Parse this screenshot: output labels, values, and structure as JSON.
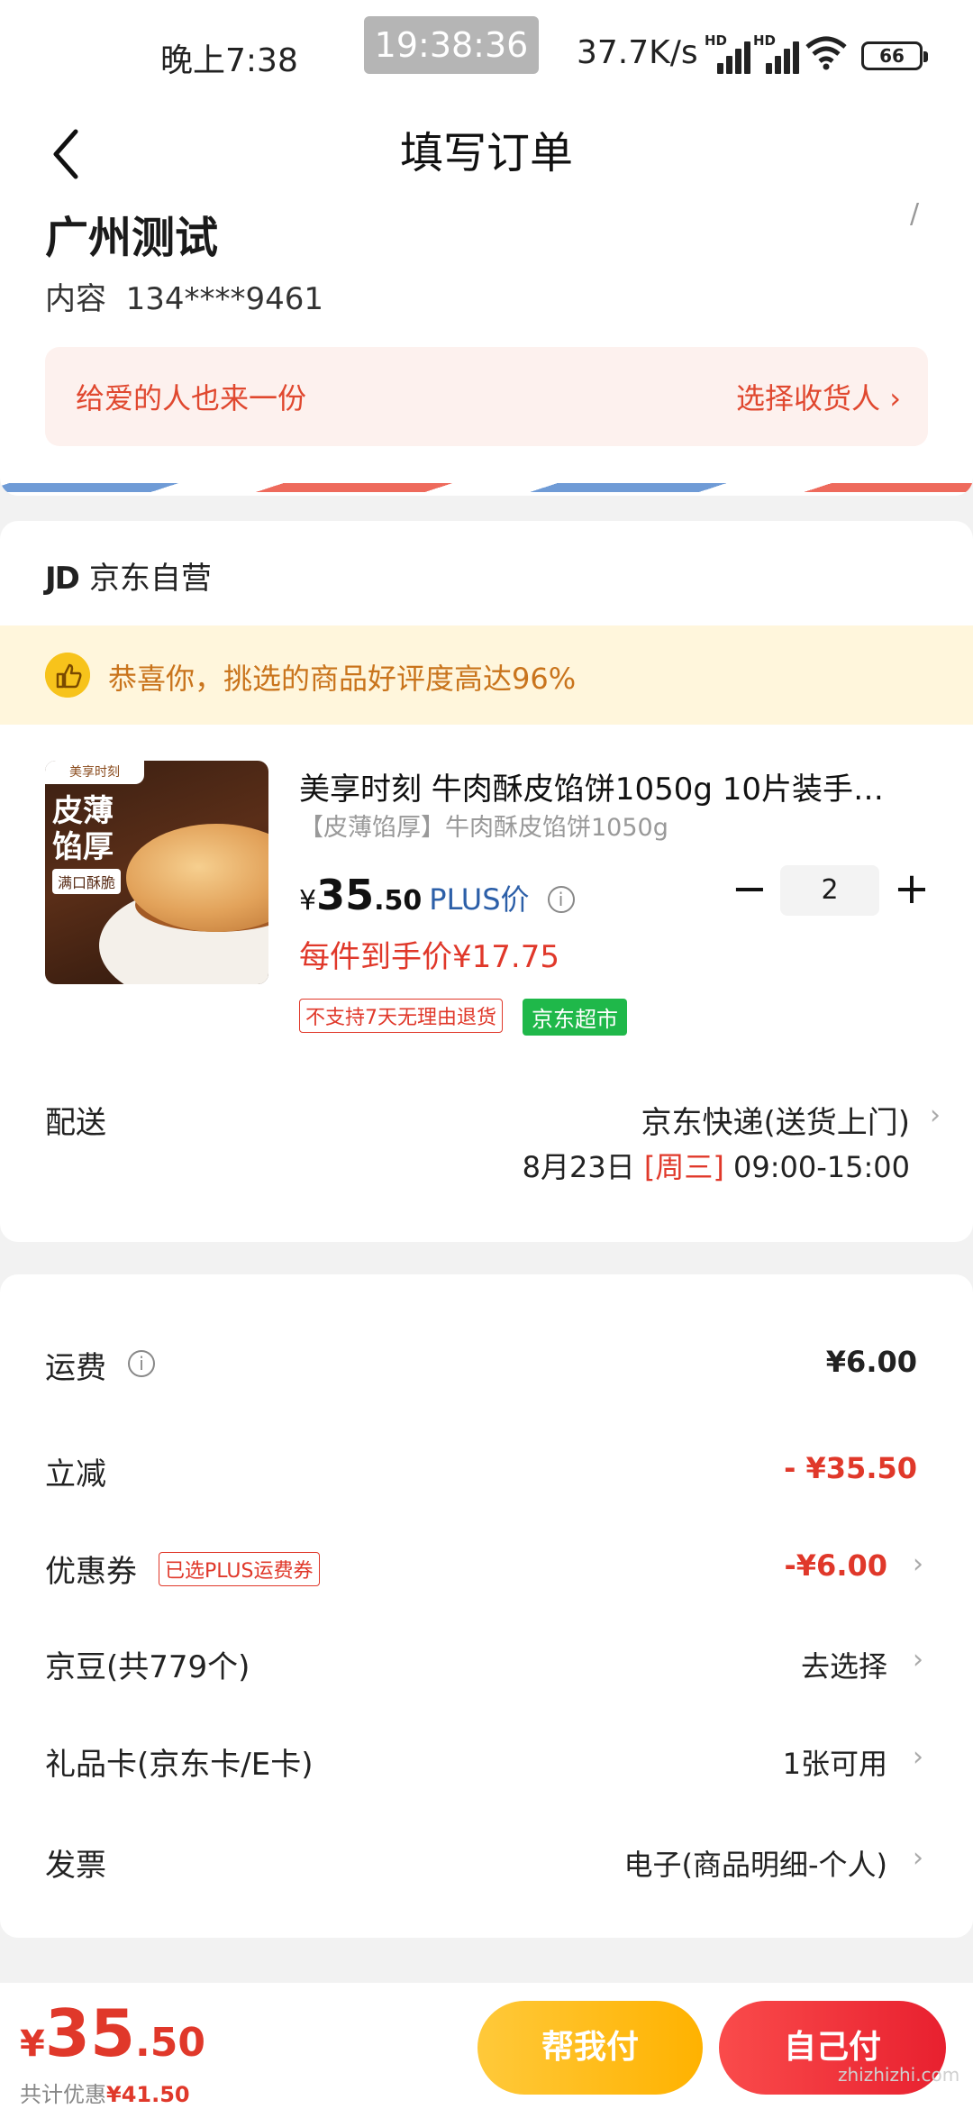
{
  "status_bar": {
    "time": "晚上7:38",
    "clock_overlay": "19:38:36",
    "net_speed": "37.7K/s",
    "signal_tag": "HD",
    "battery": "66"
  },
  "header": {
    "title": "填写订单"
  },
  "address": {
    "name": "广州测试",
    "phone_prefix": "内容",
    "phone": "134****9461",
    "gift_text": "给爱的人也来一份",
    "gift_action": "选择收货人 ›"
  },
  "shop": {
    "logo": "JD",
    "name": "京东自营",
    "praise": "恭喜你，挑选的商品好评度高达96%"
  },
  "product": {
    "image_brand": "美享时刻",
    "image_title": "皮薄馅厚",
    "image_sub": "满口酥脆",
    "title": "美享时刻 牛肉酥皮馅饼1050g 10片装手…",
    "spec": "【皮薄馅厚】牛肉酥皮馅饼1050g",
    "price_yen": "¥",
    "price_int": "35",
    "price_dec": ".50",
    "plus_label": "PLUS价",
    "quantity": "2",
    "minus": "−",
    "plus": "+",
    "unit_price": "每件到手价¥17.75",
    "tag_noreturn": "不支持7天无理由退货",
    "tag_market": "京东超市"
  },
  "delivery": {
    "label": "配送",
    "method": "京东快递(送货上门)",
    "date": "8月23日",
    "weekday": "[周三]",
    "window": "09:00-15:00"
  },
  "fees": {
    "freight_label": "运费",
    "freight_value": "¥6.00",
    "discount_label": "立减",
    "discount_value": "- ¥35.50",
    "coupon_label": "优惠券",
    "coupon_tag": "已选PLUS运费券",
    "coupon_value": "-¥6.00",
    "beans_label": "京豆(共779个)",
    "beans_value": "去选择",
    "giftcard_label": "礼品卡(京东卡/E卡)",
    "giftcard_value": "1张可用",
    "invoice_label": "发票",
    "invoice_value": "电子(商品明细-个人)"
  },
  "bottom": {
    "total_yen": "¥",
    "total_int": "35",
    "total_dec": ".50",
    "saved_label": "共计优惠",
    "saved_amount": "¥41.50",
    "help_pay": "帮我付",
    "self_pay": "自己付"
  },
  "watermark": "zhizhizhi.com",
  "colors": {
    "accent_red": "#e0382a",
    "plus_blue": "#2c5fa8",
    "market_green": "#1fb84a",
    "help_yellow": "#ffb200"
  }
}
